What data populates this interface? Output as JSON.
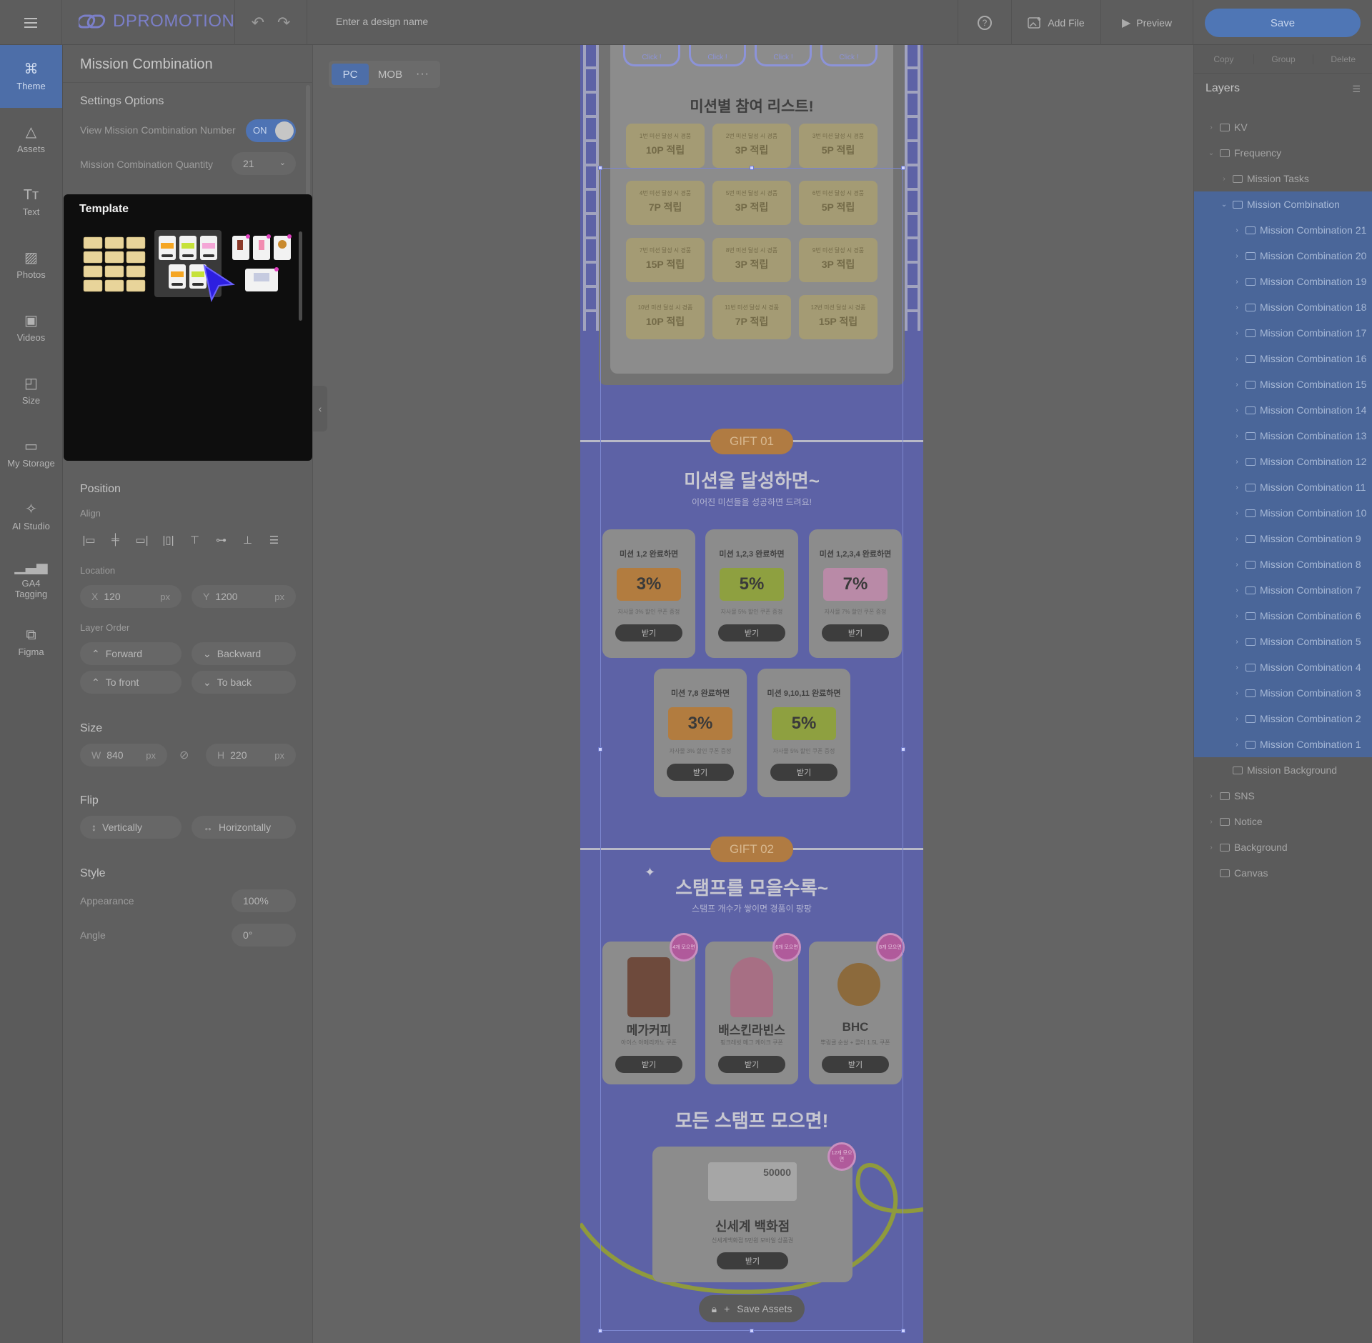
{
  "topbar": {
    "brand": "DPROMOTION",
    "design_name_placeholder": "Enter a design name",
    "add_file": "Add File",
    "preview": "Preview",
    "save": "Save"
  },
  "rail": [
    {
      "label": "Theme",
      "icon": "theme-icon"
    },
    {
      "label": "Assets",
      "icon": "assets-icon"
    },
    {
      "label": "Text",
      "icon": "text-icon"
    },
    {
      "label": "Photos",
      "icon": "photos-icon"
    },
    {
      "label": "Videos",
      "icon": "videos-icon"
    },
    {
      "label": "Size",
      "icon": "size-icon"
    },
    {
      "label": "My Storage",
      "icon": "folder-icon"
    },
    {
      "label": "AI Studio",
      "icon": "magic-wand-icon"
    },
    {
      "label": "GA4 Tagging",
      "icon": "bar-chart-icon"
    },
    {
      "label": "Figma",
      "icon": "figma-icon"
    }
  ],
  "panel": {
    "title": "Mission Combination",
    "settings": {
      "heading": "Settings Options",
      "view_number_label": "View Mission Combination Number",
      "toggle": "ON",
      "quantity_label": "Mission Combination Quantity",
      "quantity": "21"
    },
    "template": {
      "title": "Template"
    },
    "position": {
      "heading": "Position",
      "align_label": "Align",
      "location_label": "Location",
      "x_prefix": "X",
      "x": "120",
      "x_unit": "px",
      "y_prefix": "Y",
      "y": "1200",
      "y_unit": "px",
      "layer_order_label": "Layer Order",
      "forward": "Forward",
      "backward": "Backward",
      "to_front": "To front",
      "to_back": "To back"
    },
    "size": {
      "heading": "Size",
      "w_prefix": "W",
      "w": "840",
      "w_unit": "px",
      "h_prefix": "H",
      "h": "220",
      "h_unit": "px"
    },
    "flip": {
      "heading": "Flip",
      "vertically": "Vertically",
      "horizontally": "Horizontally"
    },
    "style": {
      "heading": "Style",
      "appearance_label": "Appearance",
      "appearance": "100%",
      "angle_label": "Angle",
      "angle": "0°"
    }
  },
  "device_tabs": {
    "pc": "PC",
    "mob": "MOB",
    "more": "···"
  },
  "artboard": {
    "click_labels": [
      "Click !",
      "Click !",
      "Click !",
      "Click !"
    ],
    "list_title": "미션별 참여 리스트!",
    "missions": [
      {
        "sub": "1번 미션 달성 시 경품",
        "pts": "10P 적립"
      },
      {
        "sub": "2번 미션 달성 시 경품",
        "pts": "3P 적립"
      },
      {
        "sub": "3번 미션 달성 시 경품",
        "pts": "5P 적립"
      },
      {
        "sub": "4번 미션 달성 시 경품",
        "pts": "7P 적립"
      },
      {
        "sub": "5번 미션 달성 시 경품",
        "pts": "3P 적립"
      },
      {
        "sub": "6번 미션 달성 시 경품",
        "pts": "5P 적립"
      },
      {
        "sub": "7번 미션 달성 시 경품",
        "pts": "15P 적립"
      },
      {
        "sub": "8번 미션 달성 시 경품",
        "pts": "3P 적립"
      },
      {
        "sub": "9번 미션 달성 시 경품",
        "pts": "3P 적립"
      },
      {
        "sub": "10번 미션 달성 시 경품",
        "pts": "10P 적립"
      },
      {
        "sub": "11번 미션 달성 시 경품",
        "pts": "7P 적립"
      },
      {
        "sub": "12번 미션 달성 시 경품",
        "pts": "15P 적립"
      }
    ],
    "gift1": {
      "tag": "GIFT 01",
      "title": "미션을 달성하면~",
      "subtitle": "이어진 미션들을 성공하면 드려요!",
      "coupons": [
        {
          "title": "미션 1,2 완료하면",
          "value": "3%",
          "desc": "자사몰 3% 할인 쿠폰 증정",
          "btn": "받기",
          "color": "#b27c3f"
        },
        {
          "title": "미션 1,2,3 완료하면",
          "value": "5%",
          "desc": "자사몰 5% 할인 쿠폰 증정",
          "btn": "받기",
          "color": "#8ea040"
        },
        {
          "title": "미션 1,2,3,4 완료하면",
          "value": "7%",
          "desc": "자사몰 7% 할인 쿠폰 증정",
          "btn": "받기",
          "color": "#b98aa7"
        },
        {
          "title": "미션 7,8 완료하면",
          "value": "3%",
          "desc": "자사몰 3% 할인 쿠폰 증정",
          "btn": "받기",
          "color": "#b27c3f"
        },
        {
          "title": "미션 9,10,11 완료하면",
          "value": "5%",
          "desc": "자사몰 5% 할인 쿠폰 증정",
          "btn": "받기",
          "color": "#8ea040"
        }
      ]
    },
    "gift2": {
      "tag": "GIFT 02",
      "title": "스탬프를 모을수록~",
      "subtitle": "스탬프 개수가 쌓이면 경품이 팡팡",
      "products": [
        {
          "name": "메가커피",
          "desc": "아이스 아메리카노 쿠폰",
          "btn": "받기",
          "badge": "4개 모으면"
        },
        {
          "name": "배스킨라빈스",
          "desc": "핑크레빗 메그 케이크 쿠폰",
          "btn": "받기",
          "badge": "6개 모으면"
        },
        {
          "name": "BHC",
          "desc": "뿌링클 순살 + 콜라 1.5L 쿠폰",
          "btn": "받기",
          "badge": "8개 모으면"
        }
      ],
      "all_title": "모든 스탬프 모으면!",
      "final": {
        "amount": "50000",
        "name": "신세계 백화점",
        "desc": "신세계백화점 5만원 모바일 상품권",
        "btn": "받기",
        "badge": "12개 모으면"
      }
    },
    "save_assets": "Save Assets"
  },
  "layers_panel": {
    "actions": [
      "Copy",
      "Group",
      "Delete"
    ],
    "title": "Layers",
    "items": [
      {
        "label": "KV",
        "indent": 0,
        "chev": "›",
        "hl": false
      },
      {
        "label": "Frequency",
        "indent": 0,
        "chev": "⌄",
        "hl": false
      },
      {
        "label": "Mission Tasks",
        "indent": 1,
        "chev": "›",
        "hl": false
      },
      {
        "label": "Mission Combination",
        "indent": 1,
        "chev": "⌄",
        "hl": true
      },
      {
        "label": "Mission Combination 21",
        "indent": 2,
        "chev": "›",
        "hl": true
      },
      {
        "label": "Mission Combination 20",
        "indent": 2,
        "chev": "›",
        "hl": true
      },
      {
        "label": "Mission Combination 19",
        "indent": 2,
        "chev": "›",
        "hl": true
      },
      {
        "label": "Mission Combination 18",
        "indent": 2,
        "chev": "›",
        "hl": true
      },
      {
        "label": "Mission Combination 17",
        "indent": 2,
        "chev": "›",
        "hl": true
      },
      {
        "label": "Mission Combination 16",
        "indent": 2,
        "chev": "›",
        "hl": true
      },
      {
        "label": "Mission Combination 15",
        "indent": 2,
        "chev": "›",
        "hl": true
      },
      {
        "label": "Mission Combination 14",
        "indent": 2,
        "chev": "›",
        "hl": true
      },
      {
        "label": "Mission Combination 13",
        "indent": 2,
        "chev": "›",
        "hl": true
      },
      {
        "label": "Mission Combination 12",
        "indent": 2,
        "chev": "›",
        "hl": true
      },
      {
        "label": "Mission Combination 11",
        "indent": 2,
        "chev": "›",
        "hl": true
      },
      {
        "label": "Mission Combination 10",
        "indent": 2,
        "chev": "›",
        "hl": true
      },
      {
        "label": "Mission Combination 9",
        "indent": 2,
        "chev": "›",
        "hl": true
      },
      {
        "label": "Mission Combination 8",
        "indent": 2,
        "chev": "›",
        "hl": true
      },
      {
        "label": "Mission Combination 7",
        "indent": 2,
        "chev": "›",
        "hl": true
      },
      {
        "label": "Mission Combination 6",
        "indent": 2,
        "chev": "›",
        "hl": true
      },
      {
        "label": "Mission Combination 5",
        "indent": 2,
        "chev": "›",
        "hl": true
      },
      {
        "label": "Mission Combination 4",
        "indent": 2,
        "chev": "›",
        "hl": true
      },
      {
        "label": "Mission Combination 3",
        "indent": 2,
        "chev": "›",
        "hl": true
      },
      {
        "label": "Mission Combination 2",
        "indent": 2,
        "chev": "›",
        "hl": true
      },
      {
        "label": "Mission Combination 1",
        "indent": 2,
        "chev": "›",
        "hl": true
      },
      {
        "label": "Mission Background",
        "indent": 1,
        "chev": "",
        "hl": false
      },
      {
        "label": "SNS",
        "indent": 0,
        "chev": "›",
        "hl": false
      },
      {
        "label": "Notice",
        "indent": 0,
        "chev": "›",
        "hl": false
      },
      {
        "label": "Background",
        "indent": 0,
        "chev": "›",
        "hl": false
      },
      {
        "label": "Canvas",
        "indent": 0,
        "chev": "",
        "hl": false
      }
    ]
  }
}
